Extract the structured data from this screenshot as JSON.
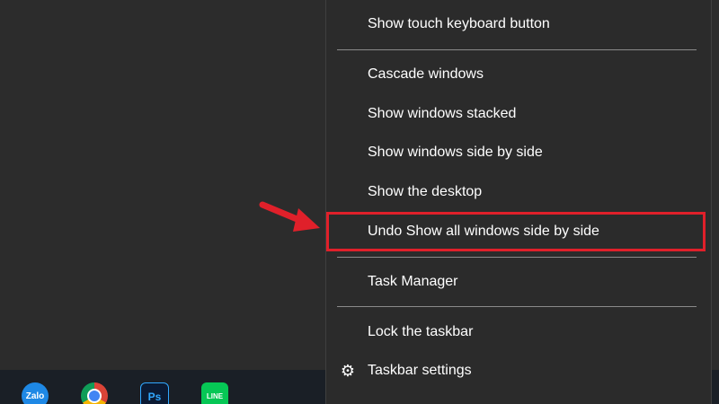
{
  "taskbar": {
    "icons": [
      {
        "name": "Zalo",
        "label": "Zalo"
      },
      {
        "name": "Chrome",
        "label": ""
      },
      {
        "name": "Photoshop",
        "label": "Ps"
      },
      {
        "name": "LINE",
        "label": "LINE"
      }
    ]
  },
  "context_menu": {
    "items": [
      {
        "label": "Show touch keyboard button"
      },
      {
        "label": "Cascade windows"
      },
      {
        "label": "Show windows stacked"
      },
      {
        "label": "Show windows side by side"
      },
      {
        "label": "Show the desktop"
      },
      {
        "label": "Undo Show all windows side by side",
        "highlighted": true
      },
      {
        "label": "Task Manager"
      },
      {
        "label": "Lock the taskbar"
      },
      {
        "label": "Taskbar settings",
        "icon": "gear-icon"
      }
    ]
  },
  "colors": {
    "highlight_border": "#e0202a",
    "arrow": "#e0202a",
    "menu_background": "#2b2b2b",
    "menu_text": "#ffffff"
  }
}
